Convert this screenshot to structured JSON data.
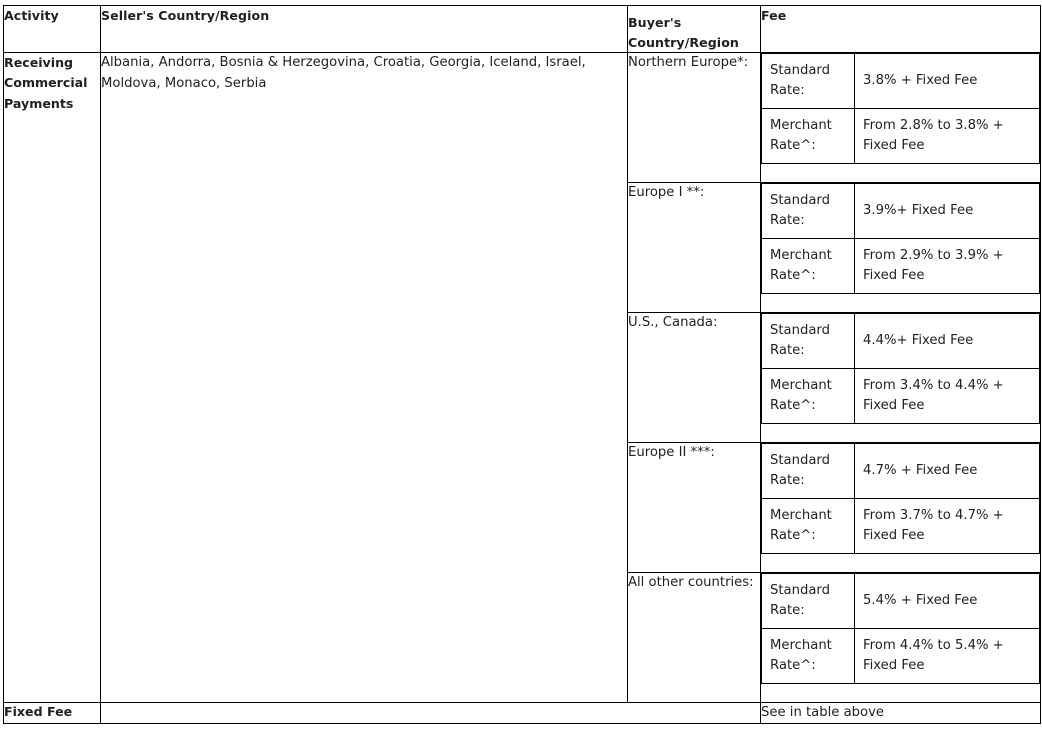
{
  "table": {
    "headers": {
      "activity": "Activity",
      "seller": "Seller's Country/Region",
      "buyer": "Buyer's Country/Region",
      "fee": "Fee"
    },
    "activity_row": {
      "activity": "Receiving Commercial Payments",
      "seller": "Albania, Andorra, Bosnia & Herzegovina, Croatia, Georgia, Iceland, Israel, Moldova, Monaco, Serbia"
    },
    "rate_labels": {
      "standard": "Standard Rate:",
      "merchant": "Merchant Rate^:"
    },
    "blocks": [
      {
        "buyer": "Northern Europe*:",
        "standard_rate": "3.8% + Fixed Fee",
        "merchant_rate": "From 2.8% to 3.8% + Fixed Fee"
      },
      {
        "buyer": "Europe I **:",
        "standard_rate": "3.9%+ Fixed Fee",
        "merchant_rate": "From 2.9% to 3.9% + Fixed Fee"
      },
      {
        "buyer": "U.S., Canada:",
        "standard_rate": "4.4%+ Fixed Fee",
        "merchant_rate": "From 3.4% to 4.4% + Fixed Fee"
      },
      {
        "buyer": "Europe II ***:",
        "standard_rate": "4.7% + Fixed Fee",
        "merchant_rate": "From 3.7% to 4.7% + Fixed Fee"
      },
      {
        "buyer": "All other countries:",
        "standard_rate": "5.4% + Fixed Fee",
        "merchant_rate": "From 4.4% to 5.4% + Fixed Fee"
      }
    ],
    "fixed_fee_row": {
      "label": "Fixed Fee",
      "blank": "",
      "value": "See in table above"
    }
  },
  "colors": {
    "text": "#231f20",
    "border": "#000000",
    "background": "#ffffff"
  }
}
